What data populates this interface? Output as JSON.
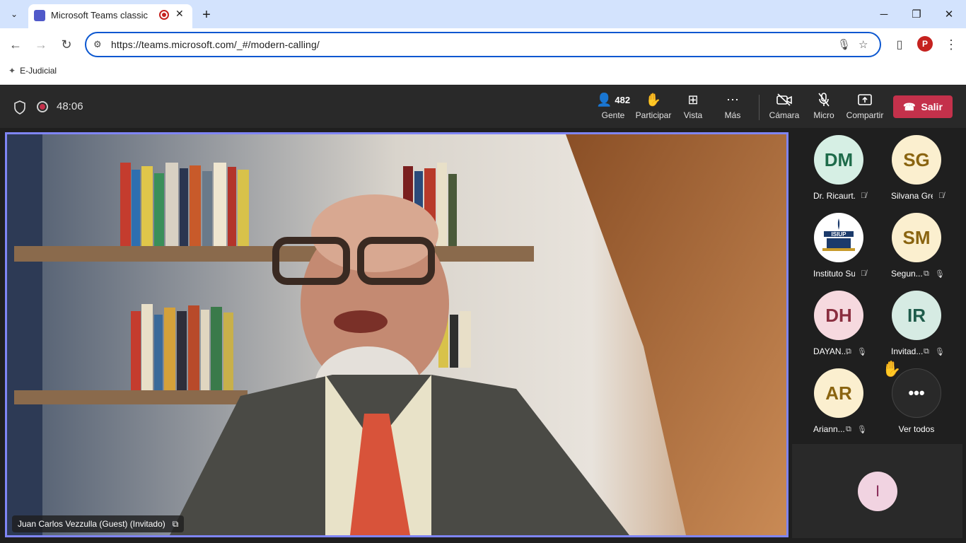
{
  "browser": {
    "tab_title": "Microsoft Teams classic",
    "url": "https://teams.microsoft.com/_#/modern-calling/",
    "profile_initial": "P",
    "bookmark": "E-Judicial"
  },
  "meeting": {
    "timer": "48:06",
    "people_count": "482",
    "buttons": {
      "people": "Gente",
      "raise": "Participar",
      "view": "Vista",
      "more": "Más",
      "camera": "Cámara",
      "mic": "Micro",
      "share": "Compartir",
      "leave": "Salir"
    },
    "speaker_name": "Juan Carlos Vezzulla (Guest) (Invitado)"
  },
  "participants": [
    {
      "initials": "DM",
      "name": "Dr. Ricaurt...",
      "bg": "#d6efe4",
      "fg": "#1e6b4a"
    },
    {
      "initials": "SG",
      "name": "Silvana Gre...",
      "bg": "#fbefcf",
      "fg": "#8a6410"
    },
    {
      "initials": "",
      "name": "Instituto Su...",
      "bg": "#ffffff",
      "fg": "#1b3a6b"
    },
    {
      "initials": "SM",
      "name": "Segun...",
      "bg": "#fbefcf",
      "fg": "#8a6410"
    },
    {
      "initials": "DH",
      "name": "DAYAN...",
      "bg": "#f6d9df",
      "fg": "#8a2e3f"
    },
    {
      "initials": "IR",
      "name": "Invitad...",
      "bg": "#d6ebe3",
      "fg": "#1e5b4a"
    },
    {
      "initials": "AR",
      "name": "Ariann...",
      "bg": "#fbefcf",
      "fg": "#8a6410"
    }
  ],
  "see_all": "Ver todos",
  "bottom_participant": "I",
  "logo_text": "ISIUP"
}
